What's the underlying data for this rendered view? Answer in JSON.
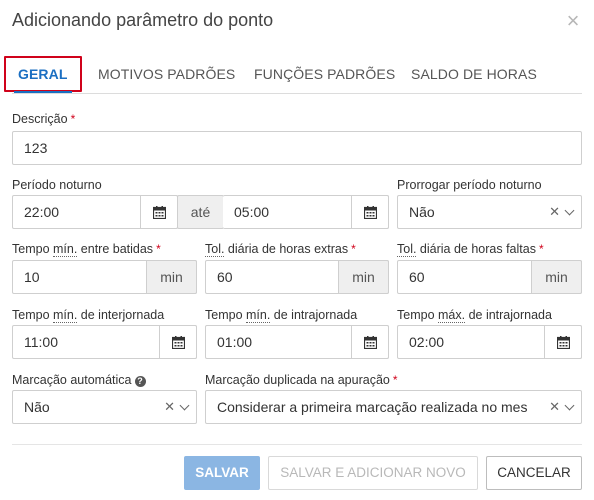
{
  "dialog": {
    "title": "Adicionando parâmetro do ponto"
  },
  "tabs": [
    {
      "label": "GERAL",
      "active": true
    },
    {
      "label": "MOTIVOS PADRÕES"
    },
    {
      "label": "FUNÇÕES PADRÕES"
    },
    {
      "label": "SALDO DE HORAS"
    }
  ],
  "descricao": {
    "label": "Descrição",
    "value": "123"
  },
  "periodo_noturno": {
    "label": "Período noturno",
    "start": "22:00",
    "separator": "até",
    "end": "05:00"
  },
  "prorrogar": {
    "label": "Prorrogar período noturno",
    "value": "Não"
  },
  "tempo_min_batidas": {
    "label_pre": "Tempo ",
    "label_abbr": "mín.",
    "label_post": " entre batidas",
    "value": "10",
    "unit": "min"
  },
  "tol_horas_extras": {
    "label_abbr": "Tol.",
    "label_post": " diária de horas extras",
    "value": "60",
    "unit": "min"
  },
  "tol_horas_faltas": {
    "label_abbr": "Tol.",
    "label_post": " diária de horas faltas",
    "value": "60",
    "unit": "min"
  },
  "tempo_min_interjornada": {
    "label_pre": "Tempo ",
    "label_abbr": "mín.",
    "label_post": " de interjornada",
    "value": "11:00"
  },
  "tempo_min_intrajornada": {
    "label_pre": "Tempo ",
    "label_abbr": "mín.",
    "label_post": " de intrajornada",
    "value": "01:00"
  },
  "tempo_max_intrajornada": {
    "label_pre": "Tempo ",
    "label_abbr": "máx.",
    "label_post": " de intrajornada",
    "value": "02:00"
  },
  "marcacao_automatica": {
    "label": "Marcação automática",
    "value": "Não"
  },
  "marcacao_duplicada": {
    "label": "Marcação duplicada na apuração",
    "value": "Considerar a primeira marcação realizada no mes..."
  },
  "footer": {
    "save": "SALVAR",
    "save_new": "SALVAR E ADICIONAR NOVO",
    "cancel": "CANCELAR"
  },
  "colors": {
    "accent": "#1b6fc2",
    "required": "#d0021b",
    "primary_button": "#8bb6e3",
    "highlight_box": "#d0021b"
  },
  "icons": {
    "close": "close-icon",
    "calendar": "calendar-icon",
    "clear": "clear-icon",
    "chevron": "chevron-down-icon",
    "help": "help-icon"
  }
}
